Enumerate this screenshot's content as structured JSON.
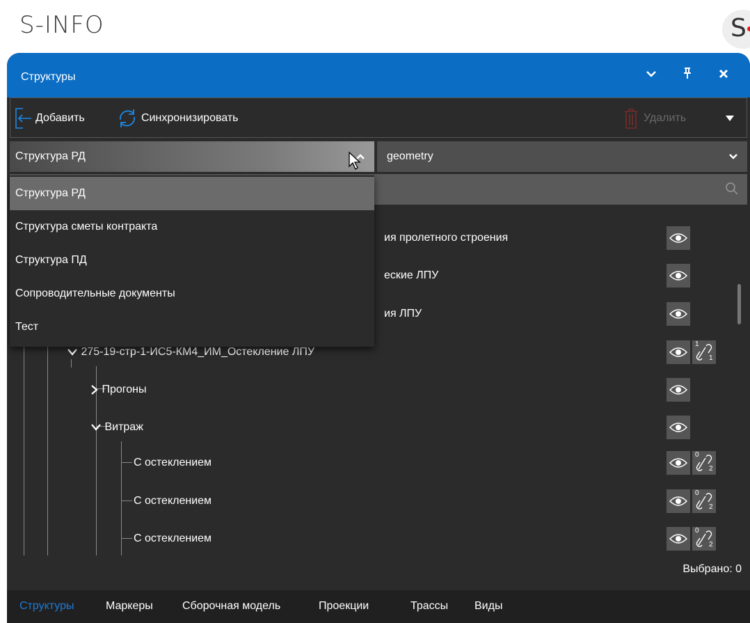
{
  "app": {
    "title": "S-INFO",
    "logo_letter": "S"
  },
  "panel": {
    "title": "Структуры",
    "header_buttons": [
      "chevron-down",
      "pin",
      "close"
    ]
  },
  "toolbar": {
    "add_label": "Добавить",
    "sync_label": "Синхронизировать",
    "delete_label": "Удалить"
  },
  "selects": {
    "structure": {
      "value": "Структура РД"
    },
    "geometry": {
      "value": "geometry"
    }
  },
  "dropdown": {
    "options": [
      "Структура РД",
      "Структура сметы контракта",
      "Структура ПД",
      "Сопроводительные документы",
      "Тест"
    ],
    "selected_index": 0
  },
  "tree": {
    "rows": [
      {
        "label": "ия пролетного строения",
        "links": null
      },
      {
        "label": "еские ЛПУ",
        "links": null
      },
      {
        "label": "ия ЛПУ",
        "links": null
      },
      {
        "label": "275-19-стр-1-ИС5-КМ4_ИМ_Остекление ЛПУ",
        "links": [
          "1",
          "1"
        ]
      },
      {
        "label": "Прогоны",
        "links": null
      },
      {
        "label": "Витраж",
        "links": null
      },
      {
        "label": "С остеклением",
        "links": [
          "0",
          "2"
        ]
      },
      {
        "label": "С остеклением",
        "links": [
          "0",
          "2"
        ]
      },
      {
        "label": "С остеклением",
        "links": [
          "0",
          "2"
        ]
      }
    ]
  },
  "status": {
    "selected_count": "Выбрано: 0"
  },
  "tabs": {
    "items": [
      "Структуры",
      "Маркеры",
      "Сборочная модель",
      "Проекции",
      "Трассы",
      "Виды"
    ],
    "active_index": 0
  },
  "colors": {
    "accent": "#0b6dc4",
    "panel_bg": "#2b2b2b",
    "active_tab": "#1e7ad6"
  }
}
